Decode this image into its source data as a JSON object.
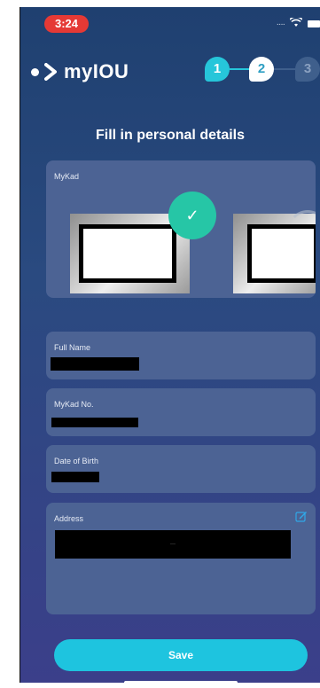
{
  "status_bar": {
    "time": "3:24",
    "signal": "····",
    "wifi": "wifi-icon",
    "battery": "battery-icon",
    "time_pill_color": "#e53935"
  },
  "brand": {
    "name": "myIOU",
    "icon": "logo-dot-chevron"
  },
  "stepper": {
    "steps": [
      "1",
      "2",
      "3"
    ],
    "current": "2",
    "active_color": "#26c6da"
  },
  "page": {
    "title": "Fill in personal details"
  },
  "mykad": {
    "label": "MyKad",
    "check_icon": "✓",
    "check_color": "#26c6a6"
  },
  "fields": {
    "full_name": {
      "label": "Full Name"
    },
    "mykad_no": {
      "label": "MyKad No."
    },
    "dob": {
      "label": "Date of Birth"
    },
    "address": {
      "label": "Address",
      "value_fragment": "—"
    }
  },
  "actions": {
    "save_label": "Save",
    "save_color": "#1ec4df"
  }
}
